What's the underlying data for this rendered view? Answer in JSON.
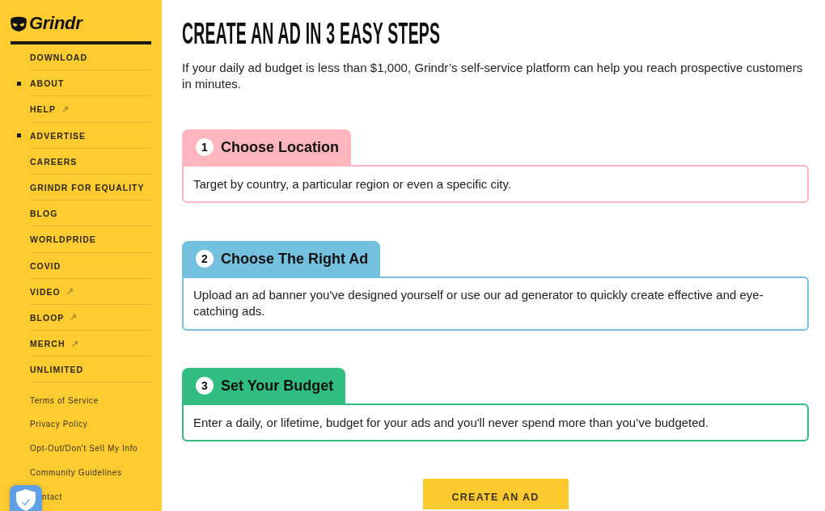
{
  "sidebar": {
    "logo": {
      "wordmark": "Grindr"
    },
    "nav": [
      {
        "label": "DOWNLOAD",
        "selected": false,
        "external": false
      },
      {
        "label": "ABOUT",
        "selected": true,
        "external": false
      },
      {
        "label": "HELP",
        "selected": false,
        "external": true
      },
      {
        "label": "ADVERTISE",
        "selected": true,
        "external": false
      },
      {
        "label": "CAREERS",
        "selected": false,
        "external": false
      },
      {
        "label": "GRINDR FOR EQUALITY",
        "selected": false,
        "external": false
      },
      {
        "label": "BLOG",
        "selected": false,
        "external": false
      },
      {
        "label": "WORLDPRIDE",
        "selected": false,
        "external": false
      },
      {
        "label": "COVID",
        "selected": false,
        "external": false
      },
      {
        "label": "VIDEO",
        "selected": false,
        "external": true
      },
      {
        "label": "BLOOP",
        "selected": false,
        "external": true
      },
      {
        "label": "MERCH",
        "selected": false,
        "external": true
      },
      {
        "label": "UNLIMITED",
        "selected": false,
        "external": false
      }
    ],
    "footer_links": [
      "Terms of Service",
      "Privacy Policy",
      "Opt-Out/Don't Sell My Info",
      "Community Guidelines",
      "ntact"
    ]
  },
  "main": {
    "title": "CREATE AN AD IN 3 EASY STEPS",
    "intro": "If your daily ad budget is less than $1,000, Grindr’s self-service platform can help you reach prospective customers in minutes.",
    "steps": [
      {
        "number": "1",
        "title": "Choose Location",
        "description": "Target by country, a particular region or even a specific city.",
        "color": "#ffb5bd"
      },
      {
        "number": "2",
        "title": "Choose The Right Ad",
        "description": "Upload an ad banner you've designed yourself or use our ad generator to quickly create effective and eye-catching ads.",
        "color": "#74c0df"
      },
      {
        "number": "3",
        "title": "Set Your Budget",
        "description": "Enter a daily, or lifetime, budget for your ads and you'll never spend more than you’ve budgeted.",
        "color": "#30bd7f"
      }
    ],
    "cta": "CREATE AN AD"
  }
}
